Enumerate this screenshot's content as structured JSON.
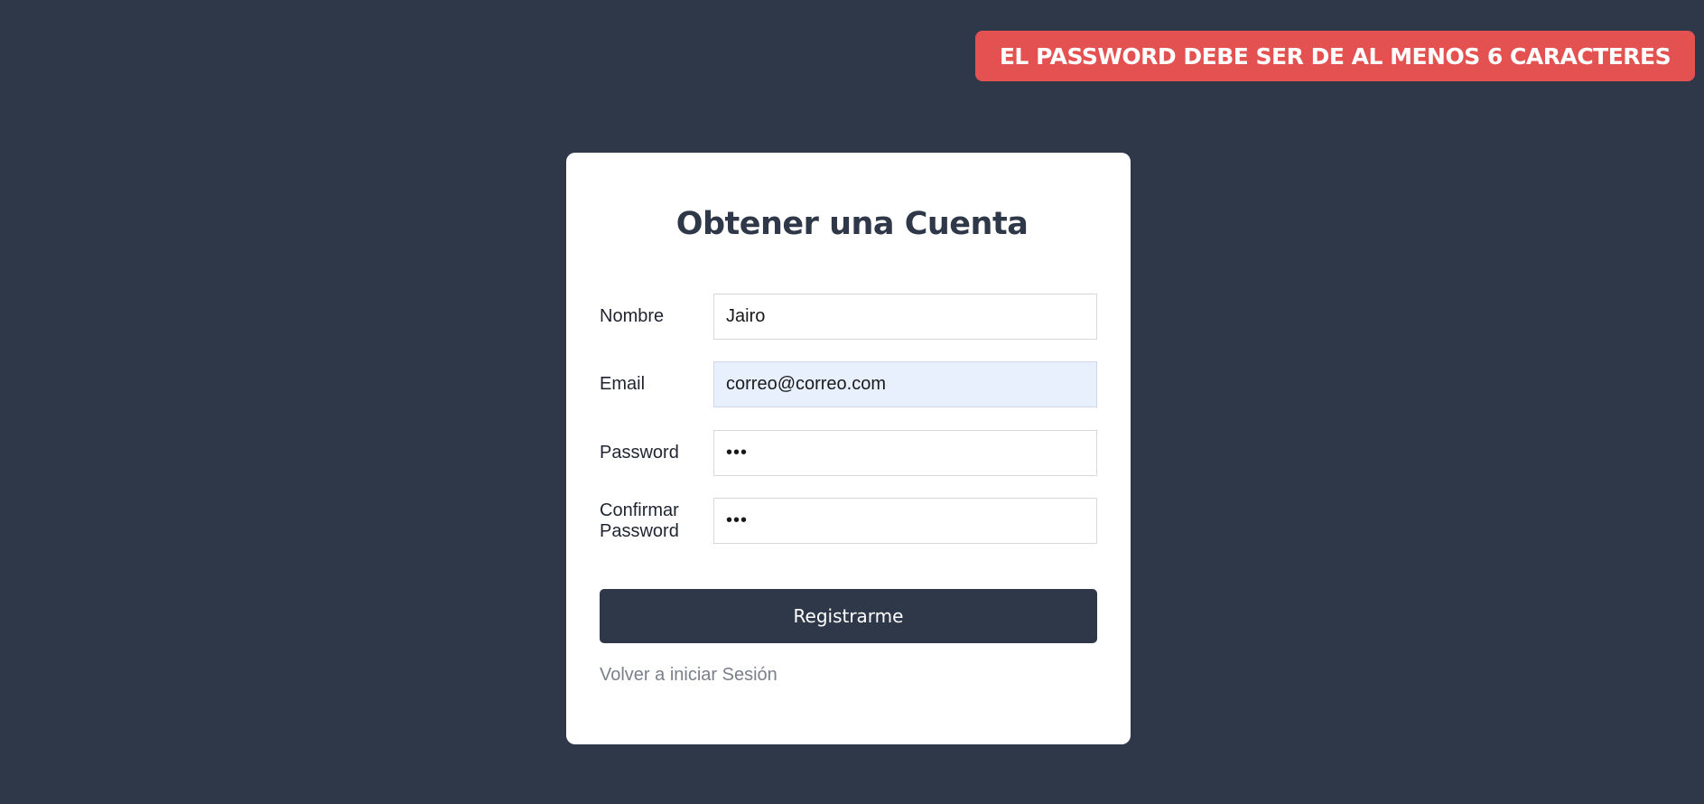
{
  "alert": {
    "message": "EL PASSWORD DEBE SER DE AL MENOS 6 CARACTERES",
    "color": "#e45151"
  },
  "form": {
    "title": "Obtener una Cuenta",
    "fields": [
      {
        "label": "Nombre",
        "value": "Jairo"
      },
      {
        "label": "Email",
        "value": "correo@correo.com"
      },
      {
        "label": "Password",
        "value": "•••"
      },
      {
        "label": "Confirmar Password",
        "value": "•••"
      }
    ],
    "submit_label": "Registrarme",
    "back_link": "Volver a iniciar Sesión"
  },
  "theme": {
    "background": "#2f3849",
    "card": "#ffffff",
    "autofill": "#e8f0fe"
  }
}
